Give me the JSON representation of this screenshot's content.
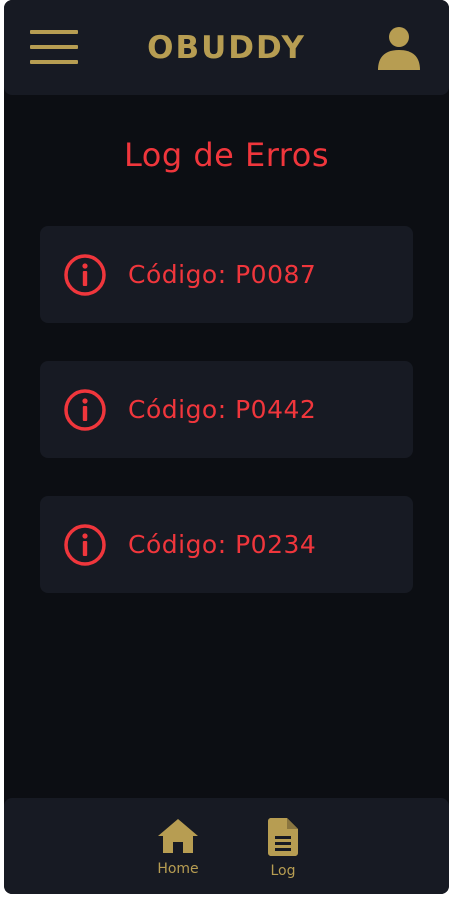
{
  "header": {
    "brand": "OBUDDY",
    "menu_icon": "hamburger-menu-icon",
    "user_icon": "user-icon"
  },
  "main": {
    "title": "Log de Erros",
    "errors": [
      {
        "label": "Código: P0087",
        "icon": "info-circle-icon"
      },
      {
        "label": "Código: P0442",
        "icon": "info-circle-icon"
      },
      {
        "label": "Código: P0234",
        "icon": "info-circle-icon"
      }
    ]
  },
  "bottom_nav": {
    "items": [
      {
        "label": "Home",
        "icon": "home-icon"
      },
      {
        "label": "Log",
        "icon": "document-icon"
      }
    ]
  },
  "colors": {
    "background": "#0c0e13",
    "surface": "#171a23",
    "accent_gold": "#b79d52",
    "error_red": "#f0363c"
  }
}
